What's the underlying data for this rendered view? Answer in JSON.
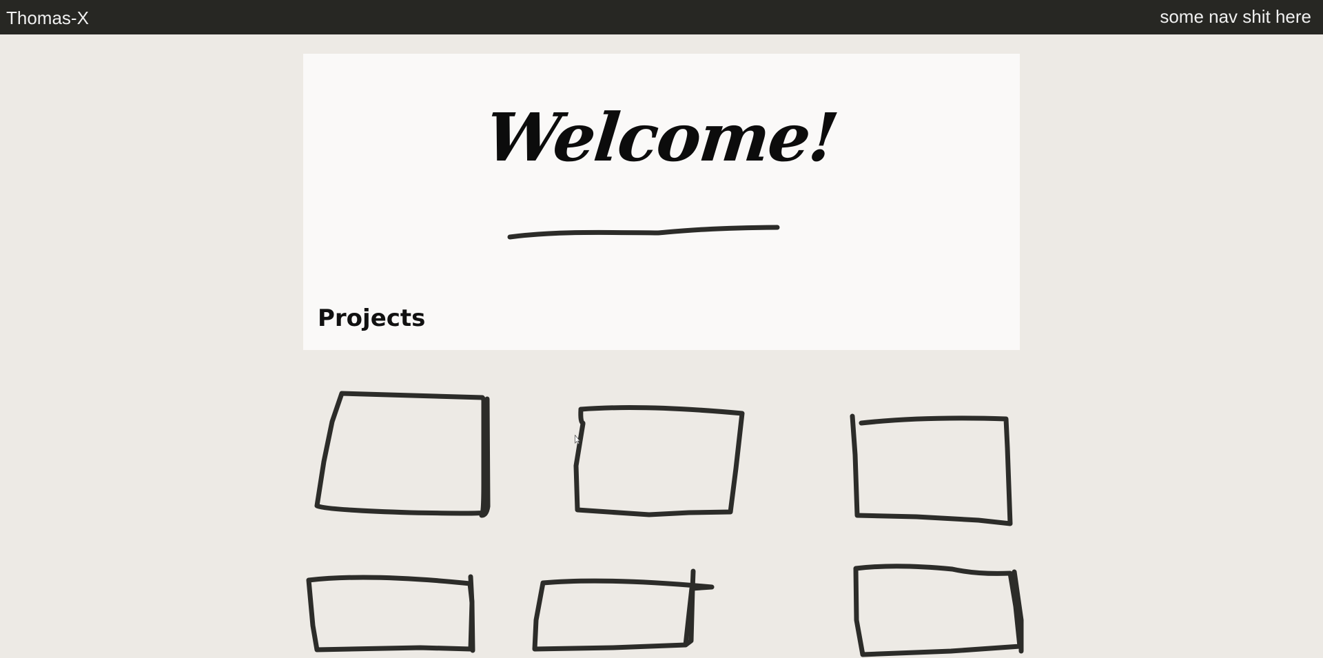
{
  "header": {
    "brand": "Thomas-X",
    "nav_text": "some nav shit here",
    "background": "#272723"
  },
  "hero": {
    "heading": "Welcome!",
    "section_title": "Projects"
  },
  "project_tiles": [
    {
      "icon": "sketch-rectangle"
    },
    {
      "icon": "sketch-rectangle"
    },
    {
      "icon": "sketch-rectangle"
    },
    {
      "icon": "sketch-rectangle"
    },
    {
      "icon": "sketch-rectangle"
    },
    {
      "icon": "sketch-rectangle"
    }
  ],
  "colors": {
    "page_background": "#edeae5",
    "card_background": "#faf9f8",
    "ink": "#2c2c29"
  }
}
